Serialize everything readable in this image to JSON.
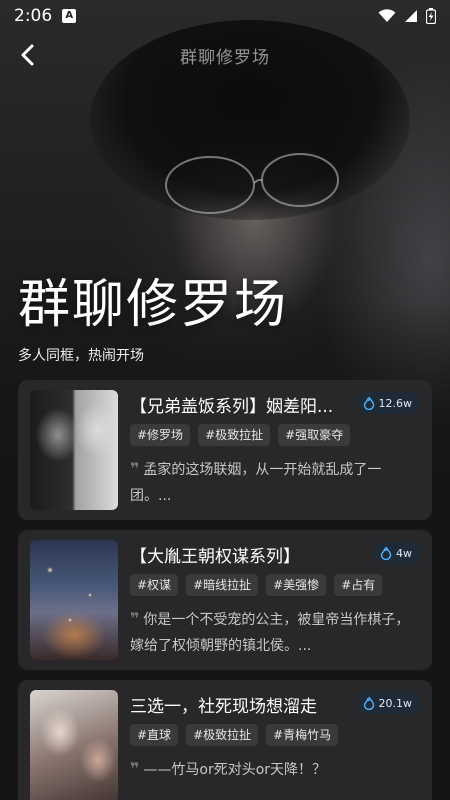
{
  "status_bar": {
    "time": "2:06",
    "notification_icon": "a-notification-icon",
    "icons": [
      "wifi-icon",
      "signal-icon",
      "battery-charging-icon"
    ]
  },
  "header": {
    "title": "群聊修罗场",
    "back_icon": "chevron-left-icon"
  },
  "hero": {
    "title": "群聊修罗场",
    "subtitle": "多人同框，热闹开场"
  },
  "cards": [
    {
      "title": "【兄弟盖饭系列】姻差阳...",
      "heat": "12.6w",
      "tags": [
        "#修罗场",
        "#极致拉扯",
        "#强取豪夺"
      ],
      "description": "孟家的这场联姻，从一开始就乱成了一团。..."
    },
    {
      "title": "【大胤王朝权谋系列】",
      "heat": "4w",
      "tags": [
        "#权谋",
        "#暗线拉扯",
        "#美强惨",
        "#占有"
      ],
      "description": "你是一个不受宠的公主，被皇帝当作棋子，嫁给了权倾朝野的镇北侯。..."
    },
    {
      "title": "三选一，社死现场想溜走",
      "heat": "20.1w",
      "tags": [
        "#直球",
        "#极致拉扯",
        "#青梅竹马"
      ],
      "description": "——竹马or死对头or天降！？"
    }
  ],
  "colors": {
    "background": "#151515",
    "card": "#2a2a2c",
    "tag": "#3a3a3d",
    "heat_icon": "#4fb3ff"
  }
}
